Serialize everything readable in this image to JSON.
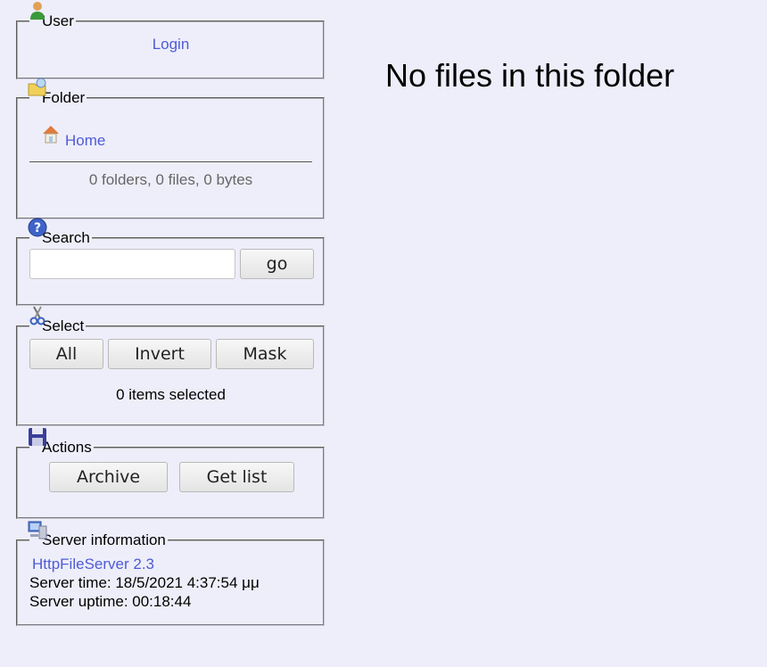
{
  "user": {
    "legend": "User",
    "login_link": "Login"
  },
  "folder": {
    "legend": "Folder",
    "home_link": "Home",
    "stats": "0 folders, 0 files, 0 bytes"
  },
  "search": {
    "legend": "Search",
    "input_value": "",
    "go_label": "go"
  },
  "select": {
    "legend": "Select",
    "all_label": "All",
    "invert_label": "Invert",
    "mask_label": "Mask",
    "status": "0 items selected"
  },
  "actions": {
    "legend": "Actions",
    "archive_label": "Archive",
    "getlist_label": "Get list"
  },
  "server": {
    "legend": "Server information",
    "product_link": "HttpFileServer 2.3",
    "time_line": "Server time: 18/5/2021 4:37:54 μμ",
    "uptime_line": "Server uptime: 00:18:44"
  },
  "main": {
    "message": "No files in this folder"
  },
  "icons": {
    "user": "user-icon",
    "folder": "folder-icon",
    "home": "home-icon",
    "search": "help-icon",
    "select": "scissors-icon",
    "actions": "floppy-disk-icon",
    "server": "computer-icon"
  },
  "colors": {
    "background": "#eeeefa",
    "link": "#4e5bd6",
    "muted_text": "#666666"
  }
}
